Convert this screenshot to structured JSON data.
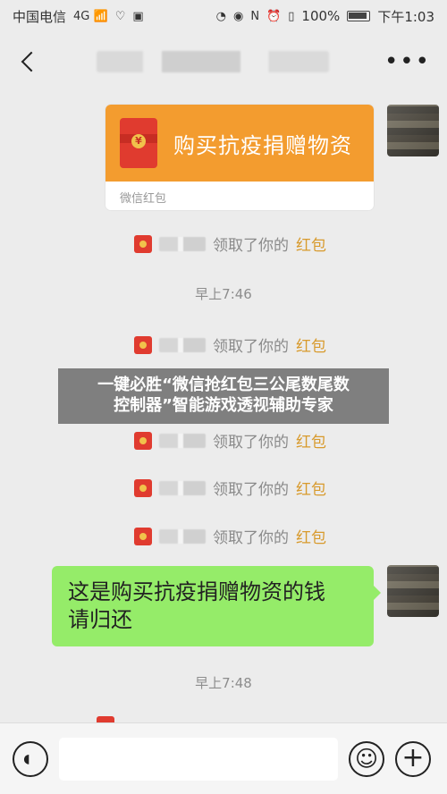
{
  "status_bar": {
    "carrier": "中国电信",
    "signal_icons": "4G 📶",
    "battery": "100%",
    "time": "下午1:03"
  },
  "nav": {
    "back": "back",
    "more": "•••"
  },
  "messages": {
    "red_packet_title": "购买抗疫捐赠物资",
    "red_packet_footer": "微信红包",
    "claimed_prefix": "领取了你的",
    "claimed_suffix": "红包",
    "time_1": "早上7:46",
    "bubble_text_line1": "这是购买抗疫捐赠物资的钱",
    "bubble_text_line2": "请归还",
    "time_2": "早上7:48"
  },
  "overlay": {
    "line1": "一键必胜“微信抢红包三公尾数尾数",
    "line2": "控制器”智能游戏透视辅助专家"
  },
  "bottom_bar": {
    "voice_icon": "voice-icon",
    "emoji_icon": "emoji-icon",
    "plus_icon": "plus-icon"
  },
  "colors": {
    "orange": "#f39c2f",
    "green": "#95ec69",
    "red": "#e03b2f"
  }
}
